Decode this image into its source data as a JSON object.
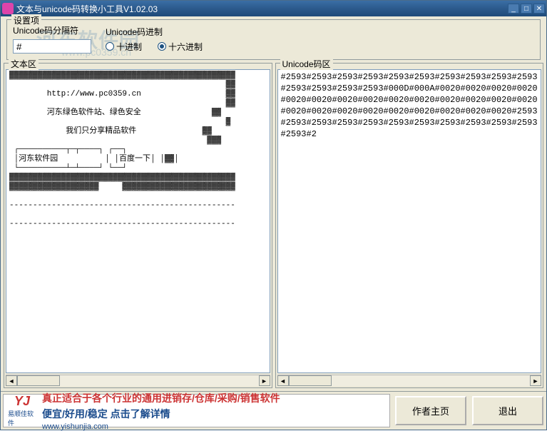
{
  "window": {
    "title": "文本与unicode码转换小工具V1.02.03"
  },
  "settings": {
    "legend": "设置项",
    "separator_label": "Unicode码分隔符",
    "separator_value": "#",
    "radix_label": "Unicode码进制",
    "radio_dec": "十进制",
    "radio_hex": "十六进制"
  },
  "watermark": {
    "main": "河东软件园",
    "sub": "www.pc0359.cn"
  },
  "panels": {
    "left_legend": "文本区",
    "right_legend": "Unicode码区",
    "left_content": "▓▓▓▓▓▓▓▓▓▓▓▓▓▓▓▓▓▓▓▓▓▓▓▓▓▓▓▓▓▓▓▓▓▓▓▓▓▓▓▓▓▓▓▓▓▓▓▓\n                                              ▓▓\n        http://www.pc0359.cn                  ▓▓\n                                              ▓▓\n        河东绿色软件站、绿色安全               ▓▓\n                                              ▓\n            我们只分享精品软件              ▓▓\n                                          ▓▓▓\n ┌──────────┬─┬────┐ ┌──┐\n │河东软件园          │ │百度一下│ │▓▓│\n └──────────┴─┴────┘ └──┘\n▓▓▓▓▓▓▓▓▓▓▓▓▓▓▓▓▓▓▓▓▓▓▓▓▓▓▓▓▓▓▓▓▓▓▓▓▓▓▓▓▓▓▓▓▓▓▓▓\n▓▓▓▓▓▓▓▓▓▓▓▓▓▓▓▓▓▓▓     ▓▓▓▓▓▓▓▓▓▓▓▓▓▓▓▓▓▓▓▓▓▓▓▓\n\n------------------------------------------------\n\n------------------------------------------------",
    "right_content": "#2593#2593#2593#2593#2593#2593#2593#2593#2593#2593#2593#2593#2593#2593#000D#000A#0020#0020#0020#0020#0020#0020#0020#0020#0020#0020#0020#0020#0020#0020#0020#0020#0020#0020#0020#0020#0020#0020#0020#2593#2593#2593#2593#2593#2593#2593#2593#2593#2593#2593#2593#2"
  },
  "bottom": {
    "ad_line1": "真正适合于各个行业的通用进销存/仓库/采购/销售软件",
    "ad_line2": "便宜/好用/稳定 点击了解详情",
    "ad_url": "www.yishunjia.com",
    "ad_logo_text": "易顺佳软件",
    "btn_home": "作者主页",
    "btn_exit": "退出"
  }
}
